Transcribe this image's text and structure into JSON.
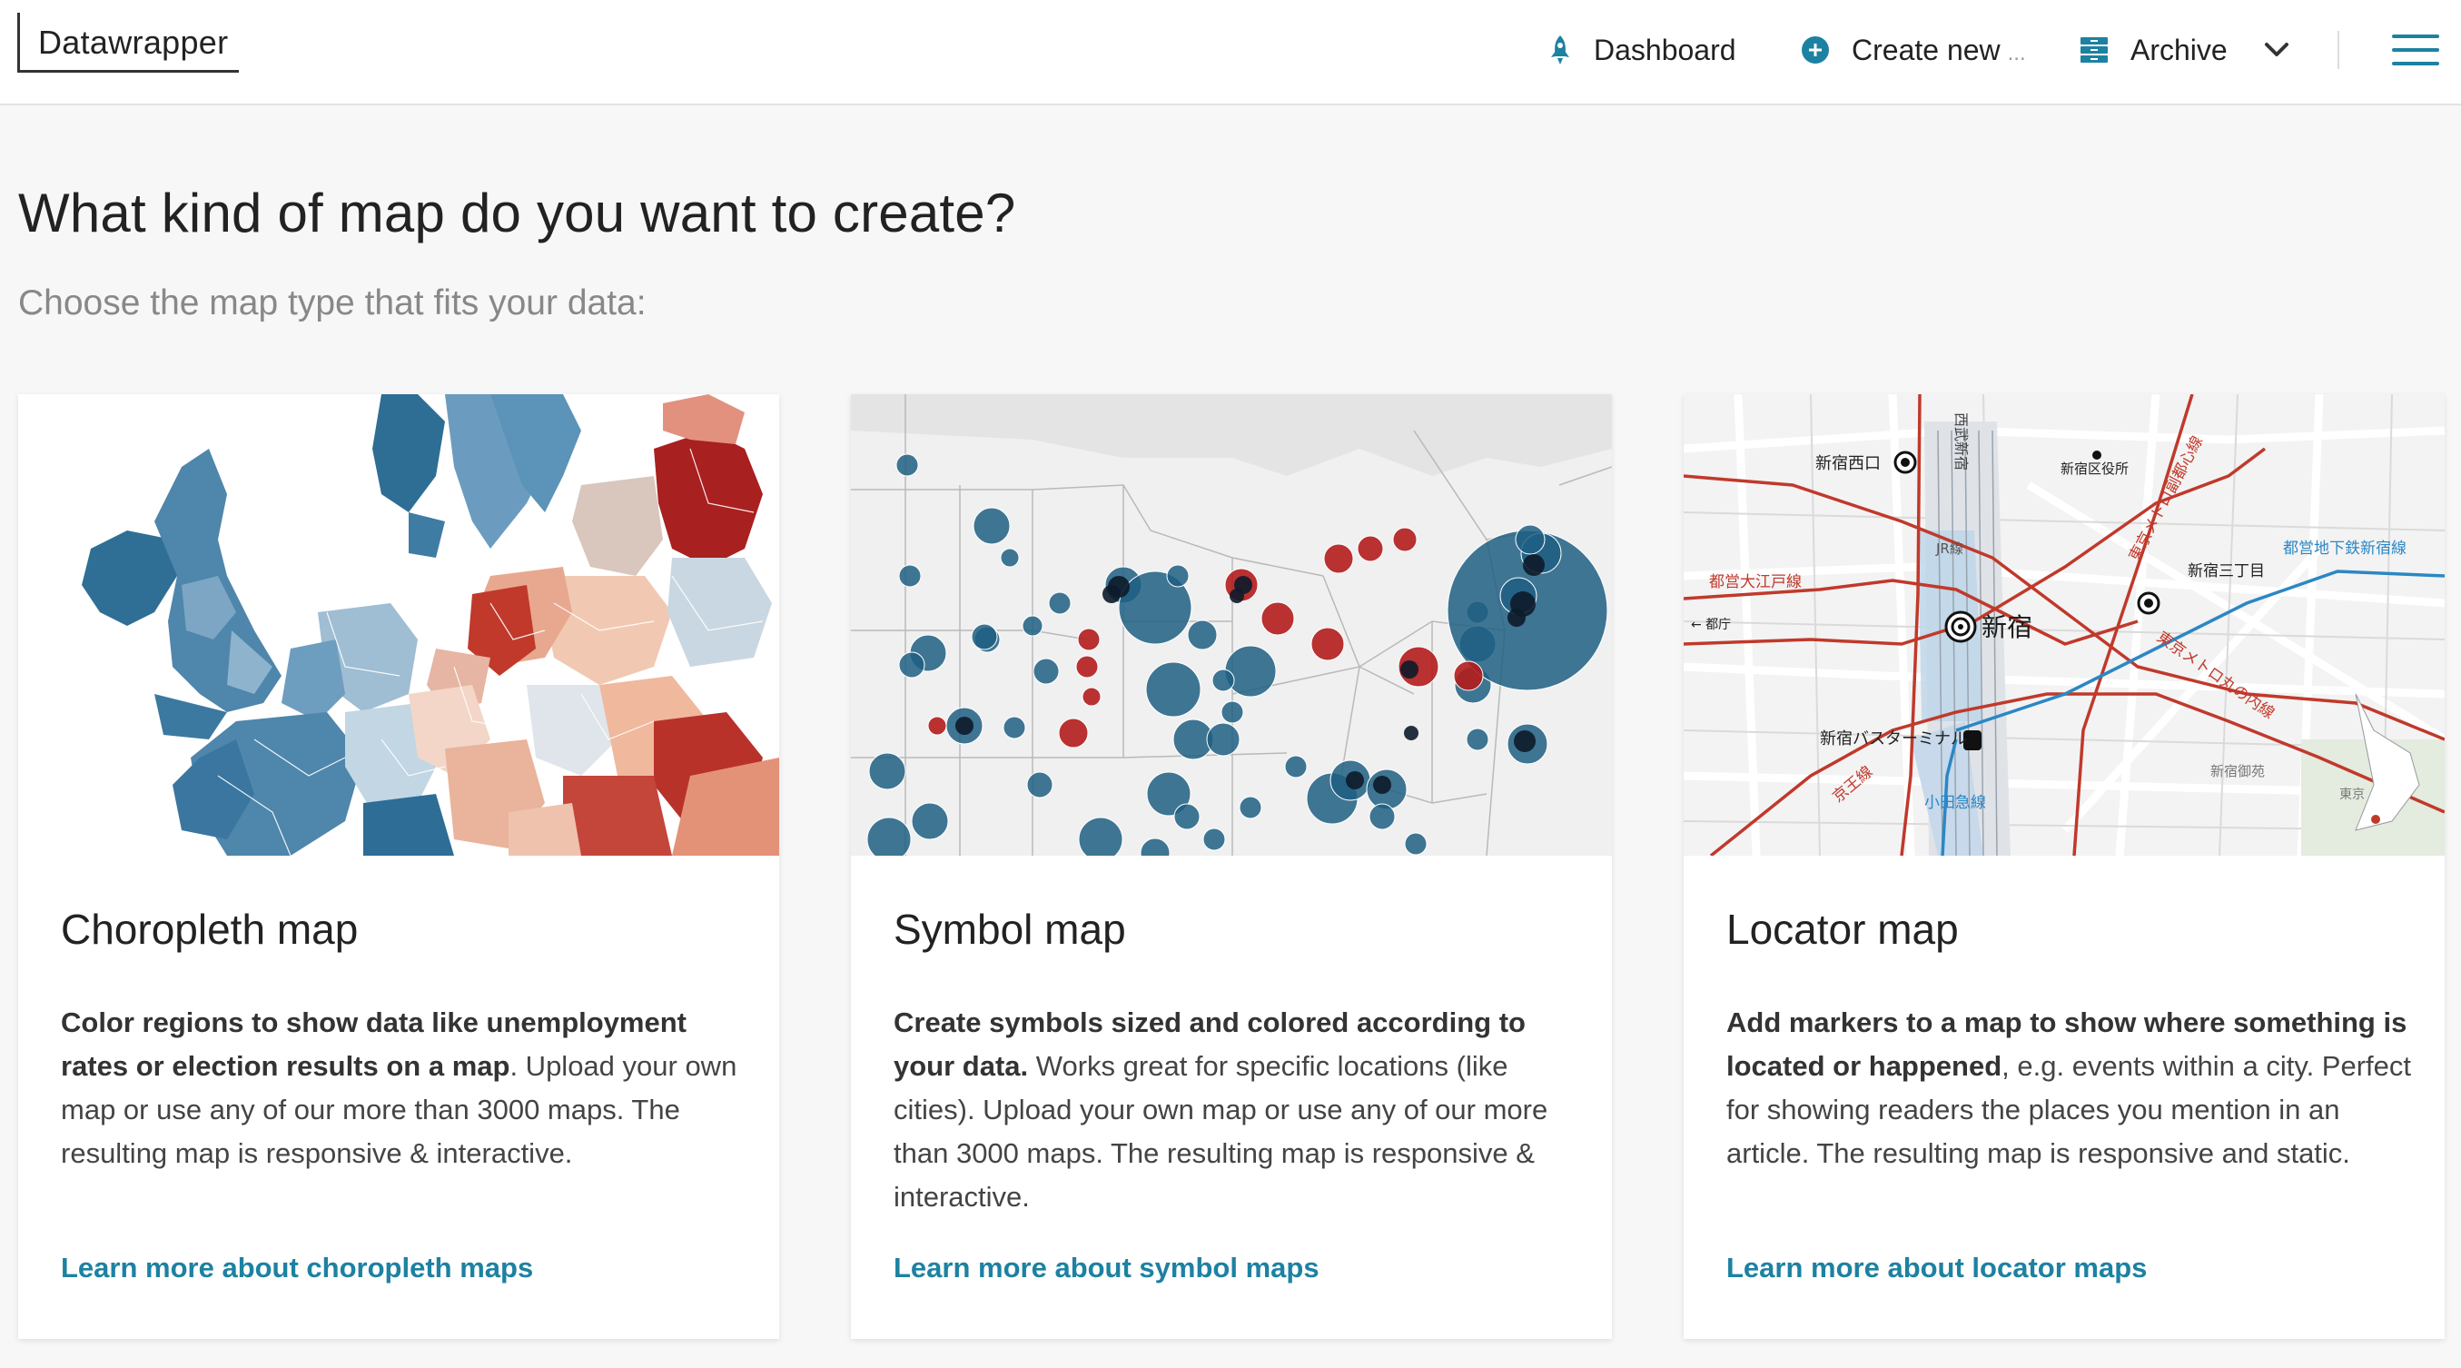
{
  "header": {
    "logo": "Datawrapper",
    "nav": {
      "dashboard": {
        "label": "Dashboard",
        "icon": "rocket-icon"
      },
      "create_new": {
        "label": "Create new",
        "suffix": "...",
        "icon": "plus-circle-icon"
      },
      "archive": {
        "label": "Archive",
        "icon": "archive-icon"
      }
    },
    "menu_icon": "hamburger-menu-icon"
  },
  "main": {
    "title": "What kind of map do you want to create?",
    "subtitle": "Choose the map type that fits your data:"
  },
  "cards": [
    {
      "title": "Choropleth map",
      "desc_bold": "Color regions to show data like unemployment rates or election results on a map",
      "desc_rest": ". Upload your own map or use any of our more than 3000 maps. The resulting map is responsive & interactive.",
      "link": "Learn more about choropleth maps"
    },
    {
      "title": "Symbol map",
      "desc_bold": "Create symbols sized and colored according to your data.",
      "desc_rest": " Works great for specific locations (like cities). Upload your own map or use any of our more than 3000 maps. The resulting map is responsive & interactive.",
      "link": "Learn more about symbol maps"
    },
    {
      "title": "Locator map",
      "desc_bold": "Add markers to a map to show where something is located or happened",
      "desc_rest": ", e.g. events within a city. Perfect for showing readers the places you mention in an article. The resulting map is responsive and static.",
      "link": "Learn more about locator maps"
    }
  ],
  "locator_map_labels": {
    "shinjuku_nishiguchi": "新宿西口",
    "seibu_shinjuku": "西武新宿",
    "ward_office": "新宿区役所",
    "metro_fukutoshin": "東京メトロ副都心線",
    "toei_oedo": "都営大江戸線",
    "jr_line": "JR線",
    "shinjuku_sanchome": "新宿三丁目",
    "toei_shinjuku": "都営地下鉄新宿線",
    "tocho": "← 都庁",
    "shinjuku": "新宿",
    "metro_marunouchi": "東京メトロ丸の内線",
    "bus_terminal": "新宿バスターミナル",
    "keio": "京王線",
    "odakyu": "小田急線",
    "gyoen": "新宿御苑",
    "tokyo": "東京"
  },
  "colors": {
    "accent": "#1d81a2",
    "symbol_blue": "#1f5f82",
    "symbol_red": "#b31c1c"
  }
}
